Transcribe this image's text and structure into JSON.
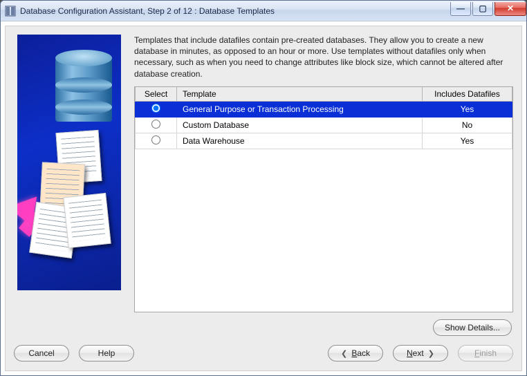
{
  "window": {
    "title": "Database Configuration Assistant, Step 2 of 12 : Database Templates"
  },
  "intro": "Templates that include datafiles contain pre-created databases. They allow you to create a new database in minutes, as opposed to an hour or more. Use templates without datafiles only when necessary, such as when you need to change attributes like block size, which cannot be altered after database creation.",
  "table": {
    "headers": {
      "select": "Select",
      "template": "Template",
      "includes": "Includes Datafiles"
    },
    "rows": [
      {
        "template": "General Purpose or Transaction Processing",
        "includes": "Yes",
        "selected": true
      },
      {
        "template": "Custom Database",
        "includes": "No",
        "selected": false
      },
      {
        "template": "Data Warehouse",
        "includes": "Yes",
        "selected": false
      }
    ]
  },
  "buttons": {
    "showDetails": "Show Details...",
    "cancel": "Cancel",
    "help": "Help",
    "back_prefix": "B",
    "back_rest": "ack",
    "next_prefix": "N",
    "next_rest": "ext",
    "finish_prefix": "F",
    "finish_rest": "inish"
  }
}
